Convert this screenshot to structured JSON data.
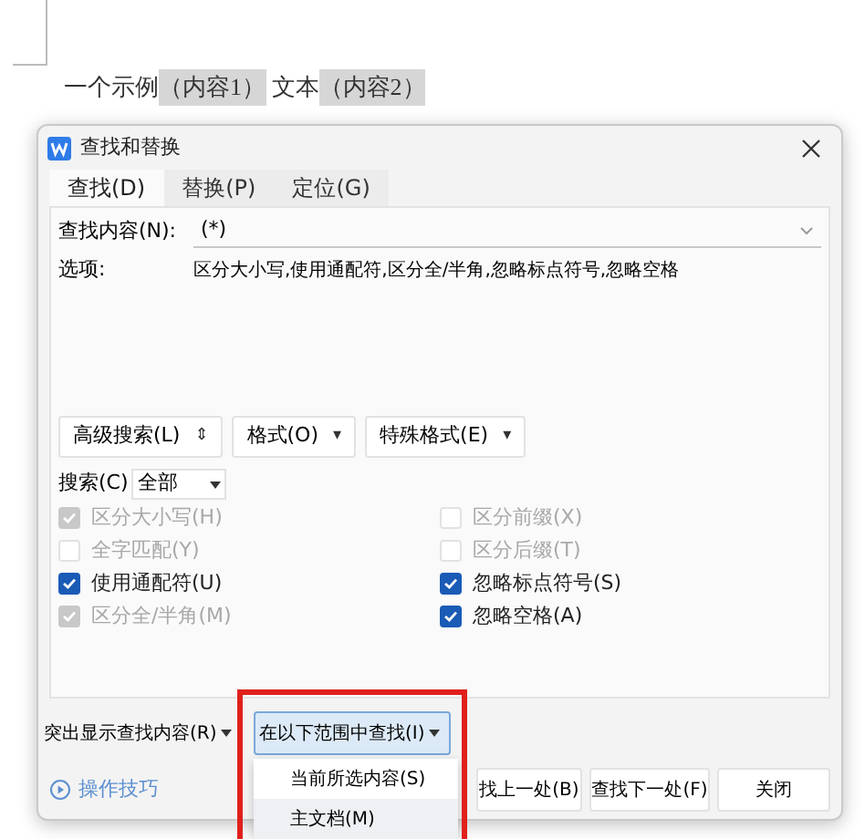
{
  "document": {
    "parts": [
      {
        "text": "一个示例",
        "shaded": false
      },
      {
        "text": "（内容1）",
        "shaded": true
      },
      {
        "text": " 文本",
        "shaded": false
      },
      {
        "text": "（内容2）",
        "shaded": true
      }
    ]
  },
  "dialog": {
    "title": "查找和替换",
    "tabs": [
      {
        "label": "查找(D)",
        "selected": true
      },
      {
        "label": "替换(P)",
        "selected": false
      },
      {
        "label": "定位(G)",
        "selected": false
      }
    ],
    "find_field": {
      "label": "查找内容(N):",
      "value": "(*)"
    },
    "options": {
      "label": "选项:",
      "value": "区分大小写,使用通配符,区分全/半角,忽略标点符号,忽略空格"
    },
    "tool_buttons": [
      {
        "label": "高级搜索(L)",
        "caret": "⇕"
      },
      {
        "label": "格式(O)",
        "caret": "▾"
      },
      {
        "label": "特殊格式(E)",
        "caret": "▾"
      }
    ],
    "search": {
      "label": "搜索(C)",
      "value": "全部"
    },
    "checkbox_columns": [
      [
        {
          "label": "区分大小写(H)",
          "checked": true,
          "disabled": true
        },
        {
          "label": "全字匹配(Y)",
          "checked": false,
          "disabled": true
        },
        {
          "label": "使用通配符(U)",
          "checked": true,
          "disabled": false
        },
        {
          "label": "区分全/半角(M)",
          "checked": true,
          "disabled": true
        }
      ],
      [
        {
          "label": "区分前缀(X)",
          "checked": false,
          "disabled": true
        },
        {
          "label": "区分后缀(T)",
          "checked": false,
          "disabled": true
        },
        {
          "label": "忽略标点符号(S)",
          "checked": true,
          "disabled": false
        },
        {
          "label": "忽略空格(A)",
          "checked": true,
          "disabled": false
        }
      ]
    ],
    "highlight_dropdown": {
      "label": "突出显示查找内容(R)"
    },
    "scope_dropdown": {
      "label": "在以下范围中查找(I)",
      "expanded": true,
      "menu": [
        {
          "label": "当前所选内容(S)",
          "selected": false
        },
        {
          "label": "主文档(M)",
          "selected": true
        }
      ]
    },
    "tips_link": "操作技巧",
    "action_buttons": [
      "找上一处(B)",
      "查找下一处(F)",
      "关闭"
    ]
  }
}
